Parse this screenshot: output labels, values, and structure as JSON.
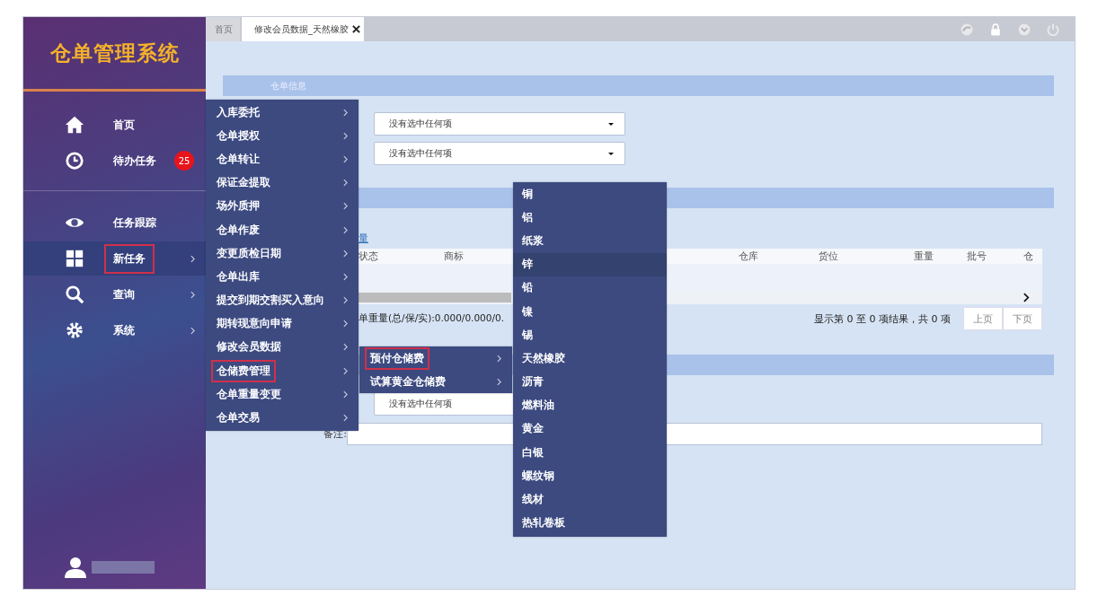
{
  "sidebar": {
    "logo": "仓单管理系统",
    "items": [
      {
        "label": "首页",
        "submenu": false,
        "selected": false,
        "highlighted": false
      },
      {
        "label": "待办任务",
        "badge": "25",
        "submenu": false,
        "selected": false,
        "highlighted": false
      },
      {
        "label": "任务跟踪",
        "submenu": false,
        "selected": false,
        "highlighted": false
      },
      {
        "label": "新任务",
        "submenu": true,
        "selected": true,
        "highlighted": true
      },
      {
        "label": "查询",
        "submenu": true,
        "selected": false,
        "highlighted": false
      },
      {
        "label": "系统",
        "submenu": true,
        "selected": false,
        "highlighted": false
      }
    ]
  },
  "tabs": [
    {
      "label": "首页",
      "selected": false,
      "closable": false
    },
    {
      "label": "修改会员数据_天然橡胶",
      "selected": true,
      "closable": true
    }
  ],
  "section_title": "仓单信息",
  "selects": [
    {
      "placeholder": "没有选中任何项"
    },
    {
      "placeholder": "没有选中任何项"
    },
    {
      "placeholder": "没有选中任何项"
    }
  ],
  "link": "量",
  "table": {
    "columns": [
      "状态",
      "商标",
      "仓库",
      "货位",
      "重量",
      "批号",
      "仓"
    ]
  },
  "summary": "单重量(总/保/实):0.000/0.000/0.",
  "pager": {
    "info": "显示第 0 至 0 项结果，共 0 项",
    "buttons": [
      "上页",
      "下页"
    ]
  },
  "remark": {
    "label": "备注:"
  },
  "menu": [
    {
      "label": "入库委托",
      "highlighted": false
    },
    {
      "label": "仓单授权",
      "highlighted": false
    },
    {
      "label": "仓单转让",
      "highlighted": false
    },
    {
      "label": "保证金提取",
      "highlighted": false
    },
    {
      "label": "场外质押",
      "highlighted": false
    },
    {
      "label": "仓单作废",
      "highlighted": false
    },
    {
      "label": "变更质检日期",
      "highlighted": false
    },
    {
      "label": "仓单出库",
      "highlighted": false
    },
    {
      "label": "提交到期交割买入意向",
      "highlighted": false
    },
    {
      "label": "期转现意向申请",
      "highlighted": false
    },
    {
      "label": "修改会员数据",
      "highlighted": false
    },
    {
      "label": "仓储费管理",
      "highlighted": true
    },
    {
      "label": "仓单重量变更",
      "highlighted": false
    },
    {
      "label": "仓单交易",
      "highlighted": false
    }
  ],
  "submenu": [
    {
      "label": "预付仓储费",
      "highlighted": true
    },
    {
      "label": "试算黄金仓储费",
      "highlighted": false
    }
  ],
  "products": [
    {
      "label": "铜",
      "selected": false
    },
    {
      "label": "铝",
      "selected": false
    },
    {
      "label": "纸浆",
      "selected": false
    },
    {
      "label": "锌",
      "selected": true
    },
    {
      "label": "铅",
      "selected": false
    },
    {
      "label": "镍",
      "selected": false
    },
    {
      "label": "锡",
      "selected": false
    },
    {
      "label": "天然橡胶",
      "selected": false
    },
    {
      "label": "沥青",
      "selected": false
    },
    {
      "label": "燃料油",
      "selected": false
    },
    {
      "label": "黄金",
      "selected": false
    },
    {
      "label": "白银",
      "selected": false
    },
    {
      "label": "螺纹钢",
      "selected": false
    },
    {
      "label": "线材",
      "selected": false
    },
    {
      "label": "热轧卷板",
      "selected": false
    }
  ]
}
